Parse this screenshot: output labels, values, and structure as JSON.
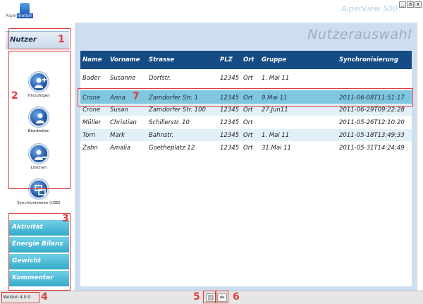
{
  "app": {
    "logo_prefix": "Aiper",
    "logo_highlight": "motion",
    "title": "AiperView 500",
    "window_controls": [
      "_",
      "á",
      "x"
    ]
  },
  "sidebar": {
    "tab_label": "Nutzer",
    "actions": [
      {
        "label": "Hinzufügen",
        "icon": "add-user-icon"
      },
      {
        "label": "Bearbeiten",
        "icon": "edit-user-icon"
      },
      {
        "label": "Löschen",
        "icon": "delete-user-icon"
      },
      {
        "label": "Synchronisieren (USB)",
        "icon": "sync-usb-icon"
      }
    ],
    "nav": [
      "Aktivität",
      "Energie Bilanz",
      "Gewicht",
      "Kommentar"
    ]
  },
  "main": {
    "heading": "Nutzerauswahl",
    "table": {
      "columns": [
        "Name",
        "Vorname",
        "Strasse",
        "PLZ",
        "Ort",
        "Gruppe",
        "Synchronisierung"
      ],
      "rows": [
        [
          "Bader",
          "Susanne",
          "Dorfstr.",
          "12345",
          "Ort",
          "1. Mai 11",
          ""
        ],
        [
          "Crone",
          "Anna",
          "Zamdorfer Str. 1",
          "12345",
          "Ort",
          "9.Mai 11",
          "2011-06-08T11:51:17"
        ],
        [
          "Crone",
          "Susan",
          "Zamdorfer Str. 100",
          "12345",
          "Ort",
          "27.Jun11",
          "2011-06-29T09:22:28"
        ],
        [
          "Müller",
          "Christian",
          "Schillerstr. 10",
          "12345",
          "Ort",
          "",
          "2011-05-26T12:10:20"
        ],
        [
          "Torn",
          "Mark",
          "Bahnstr.",
          "12345",
          "Ort",
          "1. Mai 11",
          "2011-05-18T13:49:33"
        ],
        [
          "Zahn",
          "Amalia",
          "Goetheplatz 12",
          "12345",
          "Ort",
          "31.Mai 11",
          "2011-05-31T14:24:49"
        ]
      ],
      "selected_row": 1
    }
  },
  "footer": {
    "version": "Version 4.0.0",
    "language": "de"
  },
  "annotations": [
    "1",
    "2",
    "3",
    "4",
    "5",
    "6",
    "7"
  ],
  "colors": {
    "header_blue": "#164c86",
    "panel_bg": "#cddfee",
    "nav_cyan": "#35aacb",
    "selected_row": "#7fc7df",
    "annotation_red": "#e23b3b"
  }
}
